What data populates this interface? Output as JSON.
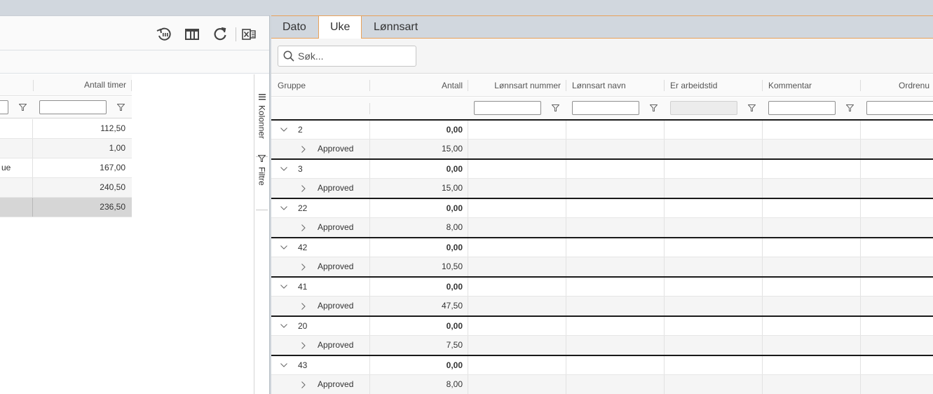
{
  "left_pane": {
    "toolbar": {
      "icons": [
        "history-icon",
        "columns-icon",
        "refresh-icon",
        "excel-export-icon"
      ]
    },
    "grid": {
      "header": {
        "col2": "Antall timer"
      },
      "rows": [
        {
          "c1": "",
          "c2": "112,50"
        },
        {
          "c1": "",
          "c2": "1,00"
        },
        {
          "c1": "ue",
          "c2": "167,00"
        },
        {
          "c1": "",
          "c2": "240,50"
        },
        {
          "c1": "",
          "c2": "236,50"
        }
      ]
    },
    "sidebar": {
      "columns_label": "Kolonner",
      "filters_label": "Filtre"
    }
  },
  "right_pane": {
    "tabs": [
      "Dato",
      "Uke",
      "Lønnsart"
    ],
    "active_tab": "Uke",
    "search": {
      "placeholder": "Søk..."
    },
    "columns": [
      "Gruppe",
      "Antall",
      "Lønnsart nummer",
      "Lønnsart navn",
      "Er arbeidstid",
      "Kommentar",
      "Ordrenu"
    ],
    "groups": [
      {
        "label": "2",
        "total": "0,00",
        "child": {
          "label": "Approved",
          "value": "15,00"
        }
      },
      {
        "label": "3",
        "total": "0,00",
        "child": {
          "label": "Approved",
          "value": "15,00"
        }
      },
      {
        "label": "22",
        "total": "0,00",
        "child": {
          "label": "Approved",
          "value": "8,00"
        }
      },
      {
        "label": "42",
        "total": "0,00",
        "child": {
          "label": "Approved",
          "value": "10,50"
        }
      },
      {
        "label": "41",
        "total": "0,00",
        "child": {
          "label": "Approved",
          "value": "47,50"
        }
      },
      {
        "label": "20",
        "total": "0,00",
        "child": {
          "label": "Approved",
          "value": "7,50"
        }
      },
      {
        "label": "43",
        "total": "0,00",
        "child": {
          "label": "Approved",
          "value": "8,00"
        }
      }
    ]
  },
  "colors": {
    "accent": "#e8a15a",
    "tab_bar": "#d1d7de",
    "group_border": "#1a1a1a"
  }
}
